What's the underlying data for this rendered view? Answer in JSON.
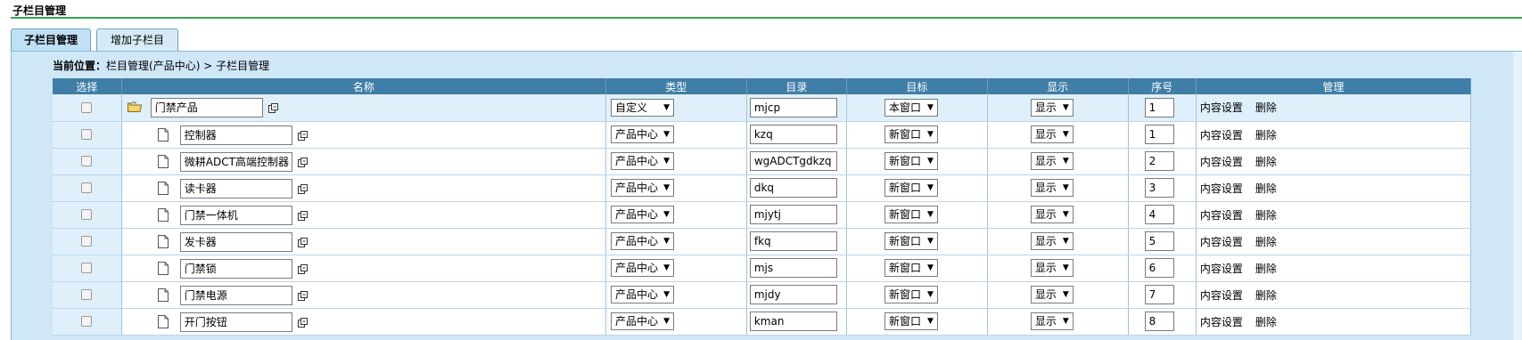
{
  "header": {
    "title": "子栏目管理"
  },
  "tabs": [
    {
      "label": "子栏目管理",
      "active": true
    },
    {
      "label": "增加子栏目",
      "active": false
    }
  ],
  "breadcrumb": {
    "prefix": "当前位置：",
    "path": "栏目管理(产品中心) > 子栏目管理"
  },
  "columns": [
    "选择",
    "名称",
    "类型",
    "目录",
    "目标",
    "显示",
    "序号",
    "管理"
  ],
  "manage_actions": {
    "content": "内容设置",
    "delete": "删除"
  },
  "colors": {
    "header_bg": "#3f7ea6",
    "panel_bg": "#cfe7f7",
    "title_line": "#3aa557"
  },
  "rows": [
    {
      "level": "parent",
      "icon": "folder-icon",
      "name": "门禁产品",
      "type": "自定义",
      "dir": "mjcp",
      "target": "本窗口",
      "show": "显示",
      "seq": "1"
    },
    {
      "level": "child",
      "icon": "file-icon",
      "name": "控制器",
      "type": "产品中心",
      "dir": "kzq",
      "target": "新窗口",
      "show": "显示",
      "seq": "1"
    },
    {
      "level": "child",
      "icon": "file-icon",
      "name": "微耕ADCT高端控制器",
      "type": "产品中心",
      "dir": "wgADCTgdkzq",
      "target": "新窗口",
      "show": "显示",
      "seq": "2"
    },
    {
      "level": "child",
      "icon": "file-icon",
      "name": "读卡器",
      "type": "产品中心",
      "dir": "dkq",
      "target": "新窗口",
      "show": "显示",
      "seq": "3"
    },
    {
      "level": "child",
      "icon": "file-icon",
      "name": "门禁一体机",
      "type": "产品中心",
      "dir": "mjytj",
      "target": "新窗口",
      "show": "显示",
      "seq": "4"
    },
    {
      "level": "child",
      "icon": "file-icon",
      "name": "发卡器",
      "type": "产品中心",
      "dir": "fkq",
      "target": "新窗口",
      "show": "显示",
      "seq": "5"
    },
    {
      "level": "child",
      "icon": "file-icon",
      "name": "门禁锁",
      "type": "产品中心",
      "dir": "mjs",
      "target": "新窗口",
      "show": "显示",
      "seq": "6"
    },
    {
      "level": "child",
      "icon": "file-icon",
      "name": "门禁电源",
      "type": "产品中心",
      "dir": "mjdy",
      "target": "新窗口",
      "show": "显示",
      "seq": "7"
    },
    {
      "level": "child",
      "icon": "file-icon",
      "name": "开门按钮",
      "type": "产品中心",
      "dir": "kman",
      "target": "新窗口",
      "show": "显示",
      "seq": "8"
    }
  ]
}
